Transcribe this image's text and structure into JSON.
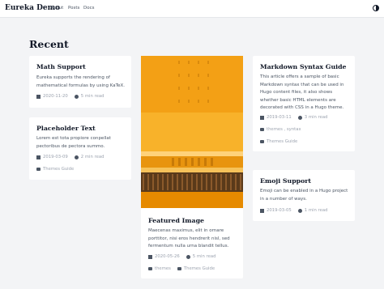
{
  "navbar": {
    "brand": "Eureka Demo",
    "links": [
      "About",
      "Posts",
      "Docs"
    ],
    "theme_icon": "half-circle-icon"
  },
  "section": {
    "title": "Recent"
  },
  "cards": [
    {
      "title": "Math Support",
      "summary_lines": [
        "Eureka supports the rendering of",
        "mathematical formulas by using KaTeX."
      ],
      "date": "2020-11-20",
      "read_time": "5 min read"
    },
    {
      "title": "Placeholder Text",
      "summary_lines": [
        "Lorem est tota propiore conpellat",
        "pectoribus de pectora summo."
      ],
      "date": "2019-03-09",
      "read_time": "2 min read",
      "categories": "Themes Guide"
    },
    {
      "title": "Featured Image",
      "summary_lines": [
        "Maecenas maximus, elit in ornare",
        "porttitor, nisi eros hendrerit nisl, sed",
        "fermentum nulla urna blandit tellus."
      ],
      "date": "2020-05-26",
      "read_time": "5 min read",
      "tags": "themes",
      "categories": "Themes Guide"
    },
    {
      "title": "Markdown Syntax Guide",
      "summary_lines": [
        "This article offers a sample of basic",
        "Markdown syntax that can be used in",
        "Hugo content files, it also shows",
        "whether basic HTML elements are",
        "decorated with CSS in a Hugo theme."
      ],
      "date": "2019-03-11",
      "read_time": "3 min read",
      "tags": "themes , syntax",
      "categories": "Themes Guide"
    },
    {
      "title": "Emoji Support",
      "summary_lines": [
        "Emoji can be enabled in a Hugo project",
        "in a number of ways."
      ],
      "date": "2019-03-05",
      "read_time": "1 min read"
    }
  ],
  "colors": {
    "accent_orange": "#f5a623",
    "hero_orange_dark": "#e68a00",
    "hero_stripe": "#5a3a1a"
  }
}
